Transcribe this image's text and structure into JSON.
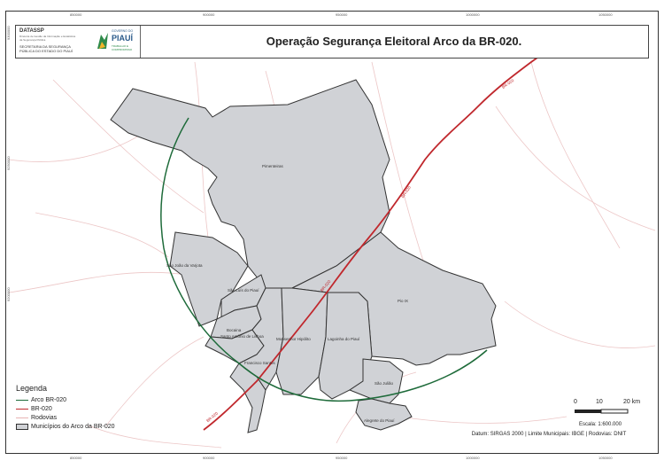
{
  "title": "Operação Segurança Eleitoral Arco da BR-020.",
  "logo": {
    "left_line1": "DATASSP",
    "left_line2": "Diretoria de Gestão da Informação e Estatística",
    "left_line3": "da Segurança Pública",
    "left_line4": "SECRETARIA DA SEGURANÇA",
    "left_line5": "PÚBLICA DO ESTADO DO PIAUÍ",
    "gov_line1": "GOVERNO DO",
    "gov_line2": "PIAUÍ",
    "gov_line3": "TRABALHO E",
    "gov_line4": "COMPROMISSO"
  },
  "legend": {
    "title": "Legenda",
    "items": [
      {
        "label": "Arco BR-020",
        "color": "#1e6b3a"
      },
      {
        "label": "BR-020",
        "color": "#c0282d"
      },
      {
        "label": "Rodovias",
        "color": "#e8b4b4"
      },
      {
        "label": "Municípios do Arco da BR-020",
        "color": "#d0d2d6"
      }
    ]
  },
  "scale": {
    "labels": [
      "0",
      "10",
      "20 km"
    ],
    "text": "Escala: 1:600.000"
  },
  "datum": "Datum: SIRGAS 2000 | Limite Municipais: IBGE | Rodovias: DNIT",
  "coords": {
    "top": [
      "850000",
      "900000",
      "950000",
      "1000000",
      "1050000"
    ],
    "bottom": [
      "850000",
      "900000",
      "950000",
      "1000000",
      "1050000"
    ],
    "left": [
      "9200000",
      "9250000",
      "9300000"
    ]
  },
  "places": [
    "Pimenteiras",
    "São João da Varjota",
    "São Luís do Piauí",
    "Bocaina",
    "Santo Antônio de Lisboa",
    "Francisco Santos",
    "Monsenhor Hipólito",
    "Lagoinha do Piauí",
    "Pio IX",
    "São Julião",
    "Alegrete do Piauí"
  ],
  "road_labels": [
    "BR-020",
    "BR-020",
    "BR-020",
    "BR-020"
  ]
}
